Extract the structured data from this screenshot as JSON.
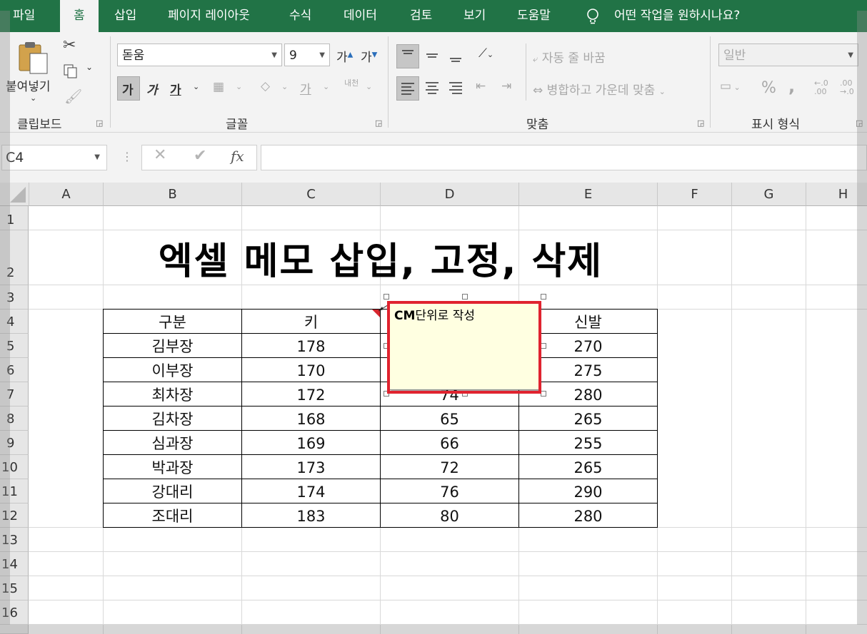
{
  "menu": {
    "tabs": [
      "파일",
      "홈",
      "삽입",
      "페이지 레이아웃",
      "수식",
      "데이터",
      "검토",
      "보기",
      "도움말"
    ],
    "active_tab": "홈",
    "tell_me": "어떤 작업을 원하시나요?"
  },
  "ribbon": {
    "clipboard": {
      "paste_label": "붙여넣기",
      "group_label": "클립보드"
    },
    "font": {
      "font_name": "돋움",
      "font_size": "9",
      "bold": "가",
      "italic": "가",
      "underline": "가",
      "grow": "가",
      "shrink": "가",
      "font_color_glyph": "가",
      "phonetic": "내천",
      "group_label": "글꼴"
    },
    "alignment": {
      "wrap_text": "자동 줄 바꿈",
      "merge_center": "병합하고 가운데 맞춤",
      "group_label": "맞춤"
    },
    "number": {
      "format": "일반",
      "percent": "%",
      "comma": ",",
      "inc_decimal": "←.0\n.00",
      "dec_decimal": ".00\n→.0",
      "group_label": "표시 형식"
    }
  },
  "formula_bar": {
    "name_box": "C4",
    "fx": "fx",
    "value": ""
  },
  "columns": [
    "A",
    "B",
    "C",
    "D",
    "E",
    "F",
    "G",
    "H"
  ],
  "rows": [
    "1",
    "2",
    "3",
    "4",
    "5",
    "6",
    "7",
    "8",
    "9",
    "10",
    "11",
    "12",
    "13",
    "14",
    "15",
    "16"
  ],
  "sheet": {
    "title": "엑셀 메모 삽입, 고정, 삭제",
    "headers": [
      "구분",
      "키",
      "",
      "신발"
    ],
    "data": [
      [
        "김부장",
        "178",
        "",
        "270"
      ],
      [
        "이부장",
        "170",
        "",
        "275"
      ],
      [
        "최차장",
        "172",
        "74",
        "280"
      ],
      [
        "김차장",
        "168",
        "65",
        "265"
      ],
      [
        "심과장",
        "169",
        "66",
        "255"
      ],
      [
        "박과장",
        "173",
        "72",
        "265"
      ],
      [
        "강대리",
        "174",
        "76",
        "290"
      ],
      [
        "조대리",
        "183",
        "80",
        "280"
      ]
    ]
  },
  "comment": {
    "bold_part": "CM",
    "rest": "단위로 작성"
  },
  "colors": {
    "accent": "#217346",
    "highlight": "#e0232f",
    "memo_bg": "#ffffe1"
  }
}
